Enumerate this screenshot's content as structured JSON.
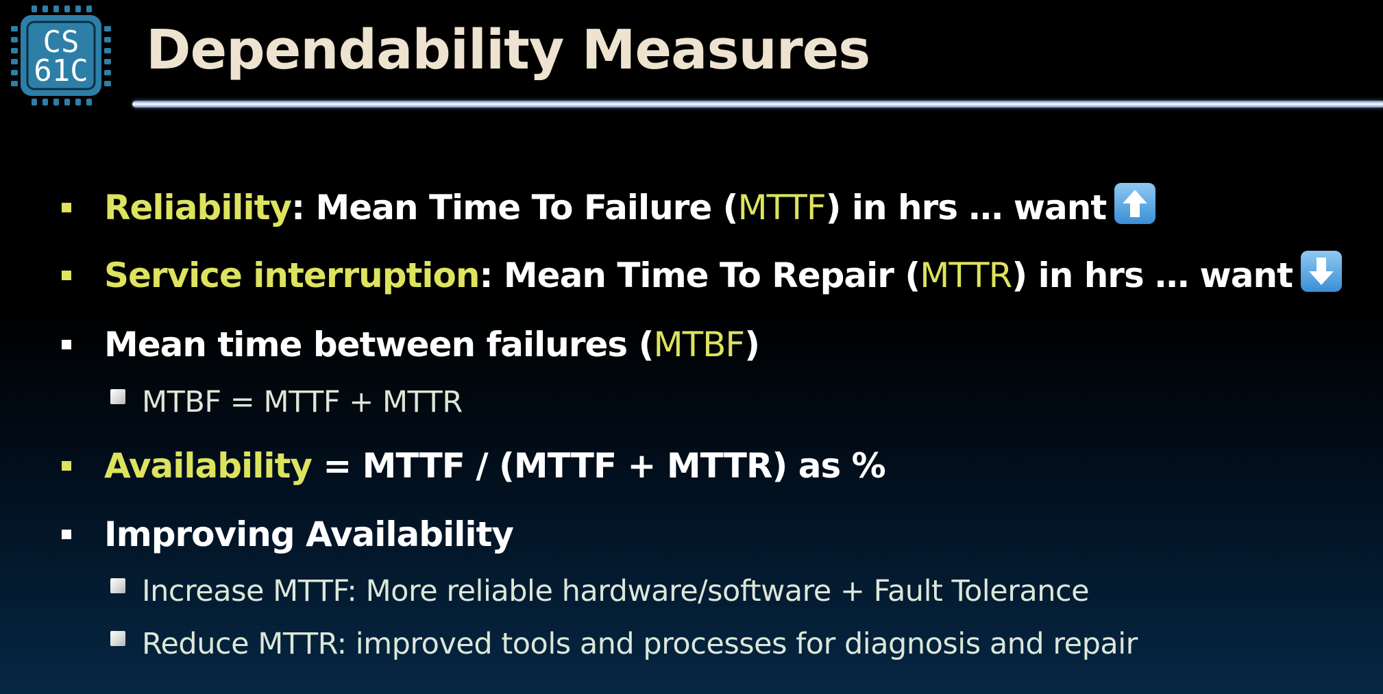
{
  "slide": {
    "logo_text_top": "CS",
    "logo_text_bottom": "61C",
    "title": "Dependability Measures"
  },
  "colors": {
    "accent": "#dde35e",
    "logo_fill": "#2d7fa8",
    "title": "#eee3d0",
    "text": "#ffffff",
    "sub_text": "#dce7d8"
  },
  "bullets": {
    "reliability": {
      "term": "Reliability",
      "text_a": ": Mean Time To Failure (",
      "abbr": "MTTF",
      "text_b": ") in hrs … want",
      "icon": "up-arrow-icon"
    },
    "service": {
      "term": "Service interruption",
      "text_a": ": Mean Time To Repair (",
      "abbr": "MTTR",
      "text_b": ") in hrs … want",
      "icon": "down-arrow-icon"
    },
    "mtbf": {
      "text_a": "Mean time between failures (",
      "abbr": "MTBF",
      "text_b": ")",
      "sub": "MTBF = MTTF + MTTR"
    },
    "availability": {
      "term": "Availability",
      "text": " = MTTF / (MTTF + MTTR) as %"
    },
    "improving": {
      "text": "Improving Availability",
      "subs": [
        "Increase MTTF: More reliable hardware/software + Fault Tolerance",
        "Reduce MTTR: improved tools and processes for diagnosis and repair"
      ]
    }
  }
}
